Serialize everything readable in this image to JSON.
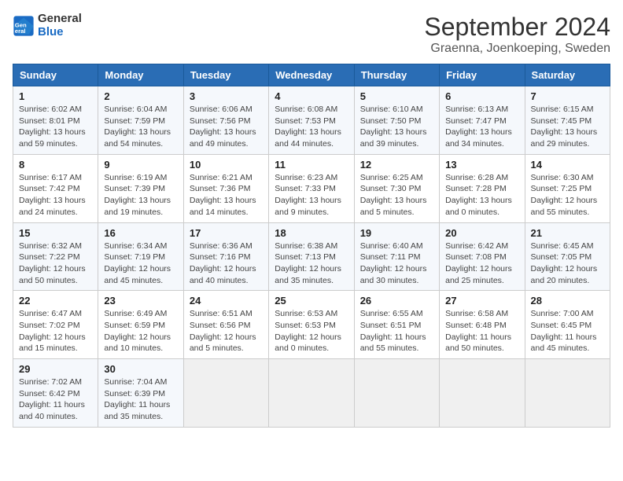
{
  "header": {
    "logo_line1": "General",
    "logo_line2": "Blue",
    "month_year": "September 2024",
    "location": "Graenna, Joenkoeping, Sweden"
  },
  "days_of_week": [
    "Sunday",
    "Monday",
    "Tuesday",
    "Wednesday",
    "Thursday",
    "Friday",
    "Saturday"
  ],
  "weeks": [
    [
      {
        "day": "1",
        "info": "Sunrise: 6:02 AM\nSunset: 8:01 PM\nDaylight: 13 hours\nand 59 minutes."
      },
      {
        "day": "2",
        "info": "Sunrise: 6:04 AM\nSunset: 7:59 PM\nDaylight: 13 hours\nand 54 minutes."
      },
      {
        "day": "3",
        "info": "Sunrise: 6:06 AM\nSunset: 7:56 PM\nDaylight: 13 hours\nand 49 minutes."
      },
      {
        "day": "4",
        "info": "Sunrise: 6:08 AM\nSunset: 7:53 PM\nDaylight: 13 hours\nand 44 minutes."
      },
      {
        "day": "5",
        "info": "Sunrise: 6:10 AM\nSunset: 7:50 PM\nDaylight: 13 hours\nand 39 minutes."
      },
      {
        "day": "6",
        "info": "Sunrise: 6:13 AM\nSunset: 7:47 PM\nDaylight: 13 hours\nand 34 minutes."
      },
      {
        "day": "7",
        "info": "Sunrise: 6:15 AM\nSunset: 7:45 PM\nDaylight: 13 hours\nand 29 minutes."
      }
    ],
    [
      {
        "day": "8",
        "info": "Sunrise: 6:17 AM\nSunset: 7:42 PM\nDaylight: 13 hours\nand 24 minutes."
      },
      {
        "day": "9",
        "info": "Sunrise: 6:19 AM\nSunset: 7:39 PM\nDaylight: 13 hours\nand 19 minutes."
      },
      {
        "day": "10",
        "info": "Sunrise: 6:21 AM\nSunset: 7:36 PM\nDaylight: 13 hours\nand 14 minutes."
      },
      {
        "day": "11",
        "info": "Sunrise: 6:23 AM\nSunset: 7:33 PM\nDaylight: 13 hours\nand 9 minutes."
      },
      {
        "day": "12",
        "info": "Sunrise: 6:25 AM\nSunset: 7:30 PM\nDaylight: 13 hours\nand 5 minutes."
      },
      {
        "day": "13",
        "info": "Sunrise: 6:28 AM\nSunset: 7:28 PM\nDaylight: 13 hours\nand 0 minutes."
      },
      {
        "day": "14",
        "info": "Sunrise: 6:30 AM\nSunset: 7:25 PM\nDaylight: 12 hours\nand 55 minutes."
      }
    ],
    [
      {
        "day": "15",
        "info": "Sunrise: 6:32 AM\nSunset: 7:22 PM\nDaylight: 12 hours\nand 50 minutes."
      },
      {
        "day": "16",
        "info": "Sunrise: 6:34 AM\nSunset: 7:19 PM\nDaylight: 12 hours\nand 45 minutes."
      },
      {
        "day": "17",
        "info": "Sunrise: 6:36 AM\nSunset: 7:16 PM\nDaylight: 12 hours\nand 40 minutes."
      },
      {
        "day": "18",
        "info": "Sunrise: 6:38 AM\nSunset: 7:13 PM\nDaylight: 12 hours\nand 35 minutes."
      },
      {
        "day": "19",
        "info": "Sunrise: 6:40 AM\nSunset: 7:11 PM\nDaylight: 12 hours\nand 30 minutes."
      },
      {
        "day": "20",
        "info": "Sunrise: 6:42 AM\nSunset: 7:08 PM\nDaylight: 12 hours\nand 25 minutes."
      },
      {
        "day": "21",
        "info": "Sunrise: 6:45 AM\nSunset: 7:05 PM\nDaylight: 12 hours\nand 20 minutes."
      }
    ],
    [
      {
        "day": "22",
        "info": "Sunrise: 6:47 AM\nSunset: 7:02 PM\nDaylight: 12 hours\nand 15 minutes."
      },
      {
        "day": "23",
        "info": "Sunrise: 6:49 AM\nSunset: 6:59 PM\nDaylight: 12 hours\nand 10 minutes."
      },
      {
        "day": "24",
        "info": "Sunrise: 6:51 AM\nSunset: 6:56 PM\nDaylight: 12 hours\nand 5 minutes."
      },
      {
        "day": "25",
        "info": "Sunrise: 6:53 AM\nSunset: 6:53 PM\nDaylight: 12 hours\nand 0 minutes."
      },
      {
        "day": "26",
        "info": "Sunrise: 6:55 AM\nSunset: 6:51 PM\nDaylight: 11 hours\nand 55 minutes."
      },
      {
        "day": "27",
        "info": "Sunrise: 6:58 AM\nSunset: 6:48 PM\nDaylight: 11 hours\nand 50 minutes."
      },
      {
        "day": "28",
        "info": "Sunrise: 7:00 AM\nSunset: 6:45 PM\nDaylight: 11 hours\nand 45 minutes."
      }
    ],
    [
      {
        "day": "29",
        "info": "Sunrise: 7:02 AM\nSunset: 6:42 PM\nDaylight: 11 hours\nand 40 minutes."
      },
      {
        "day": "30",
        "info": "Sunrise: 7:04 AM\nSunset: 6:39 PM\nDaylight: 11 hours\nand 35 minutes."
      },
      {
        "day": "",
        "info": ""
      },
      {
        "day": "",
        "info": ""
      },
      {
        "day": "",
        "info": ""
      },
      {
        "day": "",
        "info": ""
      },
      {
        "day": "",
        "info": ""
      }
    ]
  ]
}
